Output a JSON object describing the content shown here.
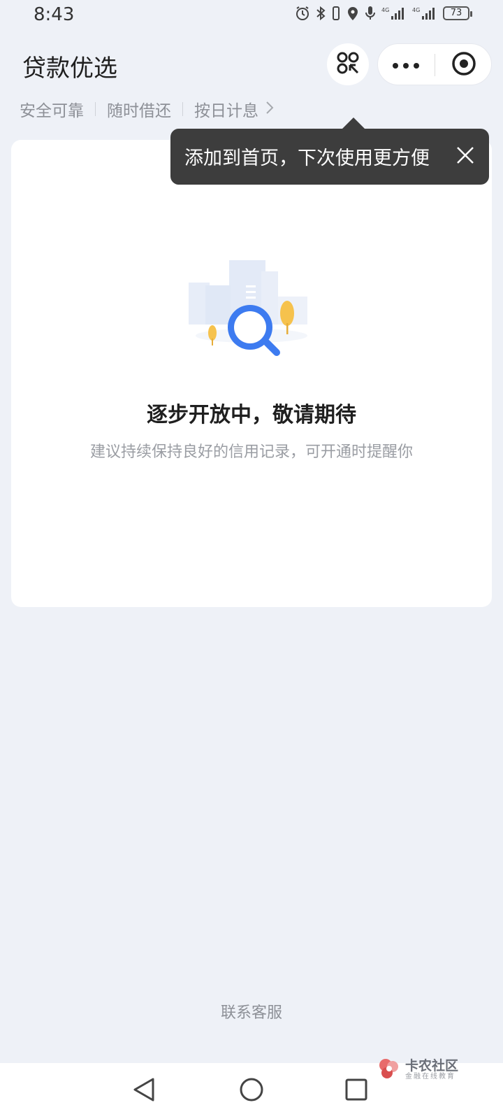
{
  "status_bar": {
    "time": "8:43",
    "battery": "73",
    "icons": [
      "alarm-icon",
      "bluetooth-icon",
      "vibrate-icon",
      "location-icon",
      "mic-icon",
      "signal-4g-icon",
      "signal-4g-icon",
      "battery-icon"
    ]
  },
  "header": {
    "title": "贷款优选"
  },
  "features": [
    "安全可靠",
    "随时借还",
    "按日计息"
  ],
  "tooltip": {
    "text": "添加到首页，下次使用更方便"
  },
  "empty_state": {
    "title": "逐步开放中，敬请期待",
    "subtitle": "建议持续保持良好的信用记录，可开通时提醒你"
  },
  "footer": {
    "contact": "联系客服"
  },
  "watermark": {
    "main": "卡农社区",
    "sub": "金融在线教育"
  },
  "colors": {
    "background": "#eef1f7",
    "card": "#ffffff",
    "tooltip": "#3d3d3d",
    "accent_blue": "#3d7bf0",
    "tree_yellow": "#f6c24d"
  }
}
